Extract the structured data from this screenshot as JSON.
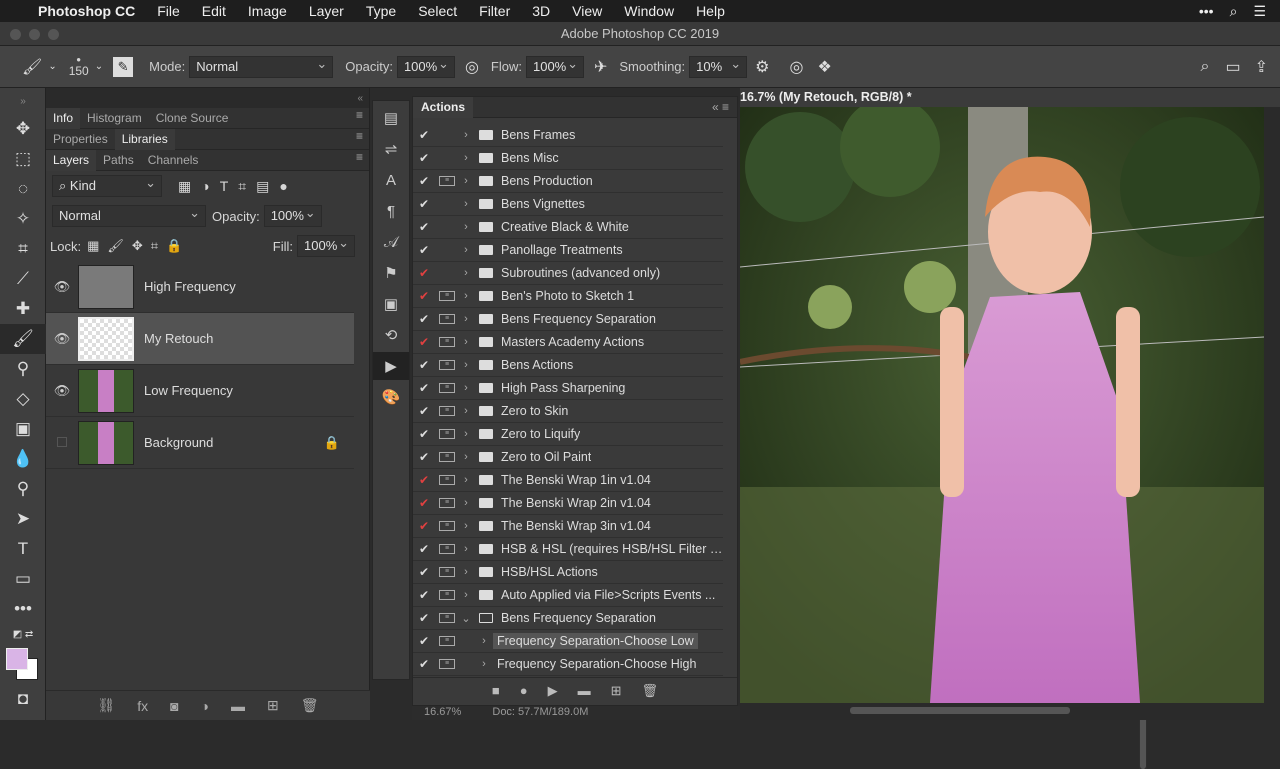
{
  "menubar": {
    "app": "Photoshop CC",
    "items": [
      "File",
      "Edit",
      "Image",
      "Layer",
      "Type",
      "Select",
      "Filter",
      "3D",
      "View",
      "Window",
      "Help"
    ]
  },
  "window_title": "Adobe Photoshop CC 2019",
  "options": {
    "brush_size": "150",
    "mode_label": "Mode:",
    "mode_value": "Normal",
    "opacity_label": "Opacity:",
    "opacity_value": "100%",
    "flow_label": "Flow:",
    "flow_value": "100%",
    "smoothing_label": "Smoothing:",
    "smoothing_value": "10%"
  },
  "left_tabs": {
    "row1": [
      "Info",
      "Histogram",
      "Clone Source"
    ],
    "row2": [
      "Properties",
      "Libraries"
    ],
    "row3": [
      "Layers",
      "Paths",
      "Channels"
    ]
  },
  "layers_panel": {
    "filter_kind": "Kind",
    "blend_mode": "Normal",
    "opacity_label": "Opacity:",
    "opacity_value": "100%",
    "lock_label": "Lock:",
    "fill_label": "Fill:",
    "fill_value": "100%",
    "layers": [
      {
        "name": "High Frequency",
        "visible": true
      },
      {
        "name": "My Retouch",
        "visible": true,
        "selected": true
      },
      {
        "name": "Low Frequency",
        "visible": true
      },
      {
        "name": "Background",
        "visible": false,
        "locked": true
      }
    ]
  },
  "actions_panel": {
    "tab": "Actions",
    "rows": [
      {
        "label": "Bens Frames",
        "check": "white",
        "dialog": false,
        "type": "set"
      },
      {
        "label": "Bens Misc",
        "check": "white",
        "dialog": false,
        "type": "set"
      },
      {
        "label": "Bens Production",
        "check": "white",
        "dialog": true,
        "type": "set"
      },
      {
        "label": "Bens Vignettes",
        "check": "white",
        "dialog": false,
        "type": "set"
      },
      {
        "label": "Creative Black & White",
        "check": "white",
        "dialog": false,
        "type": "set"
      },
      {
        "label": "Panollage Treatments",
        "check": "white",
        "dialog": false,
        "type": "set"
      },
      {
        "label": "Subroutines (advanced only)",
        "check": "red",
        "dialog": false,
        "type": "set"
      },
      {
        "label": "Ben's Photo to Sketch 1",
        "check": "red",
        "dialog": true,
        "type": "set"
      },
      {
        "label": "Bens Frequency Separation",
        "check": "white",
        "dialog": true,
        "type": "set"
      },
      {
        "label": "Masters Academy Actions",
        "check": "red",
        "dialog": true,
        "type": "set"
      },
      {
        "label": "Bens Actions",
        "check": "white",
        "dialog": true,
        "type": "set"
      },
      {
        "label": "High Pass Sharpening",
        "check": "white",
        "dialog": true,
        "type": "set"
      },
      {
        "label": "Zero to Skin",
        "check": "white",
        "dialog": true,
        "type": "set"
      },
      {
        "label": "Zero to Liquify",
        "check": "white",
        "dialog": true,
        "type": "set"
      },
      {
        "label": "Zero to Oil Paint",
        "check": "white",
        "dialog": true,
        "type": "set"
      },
      {
        "label": "The Benski Wrap 1in v1.04",
        "check": "red",
        "dialog": true,
        "type": "set"
      },
      {
        "label": "The Benski Wrap 2in v1.04",
        "check": "red",
        "dialog": true,
        "type": "set"
      },
      {
        "label": "The Benski Wrap 3in v1.04",
        "check": "red",
        "dialog": true,
        "type": "set"
      },
      {
        "label": "HSB & HSL (requires HSB/HSL Filter i...",
        "check": "white",
        "dialog": true,
        "type": "set"
      },
      {
        "label": "HSB/HSL Actions",
        "check": "white",
        "dialog": true,
        "type": "set"
      },
      {
        "label": "Auto Applied via File>Scripts Events ...",
        "check": "white",
        "dialog": true,
        "type": "set"
      },
      {
        "label": "Bens Frequency Separation",
        "check": "white",
        "dialog": true,
        "type": "open"
      },
      {
        "label": "Frequency Separation-Choose Low",
        "check": "white",
        "dialog": true,
        "type": "action",
        "highlight": true
      },
      {
        "label": "Frequency Separation-Choose High",
        "check": "white",
        "dialog": true,
        "type": "action"
      }
    ]
  },
  "document": {
    "tab_title": "16.7% (My Retouch, RGB/8) *"
  },
  "status": {
    "zoom": "16.67%",
    "doc": "Doc: 57.7M/189.0M"
  },
  "colors": {
    "foreground": "#d9b4e6",
    "background": "#ffffff",
    "check_red": "#e04040"
  }
}
